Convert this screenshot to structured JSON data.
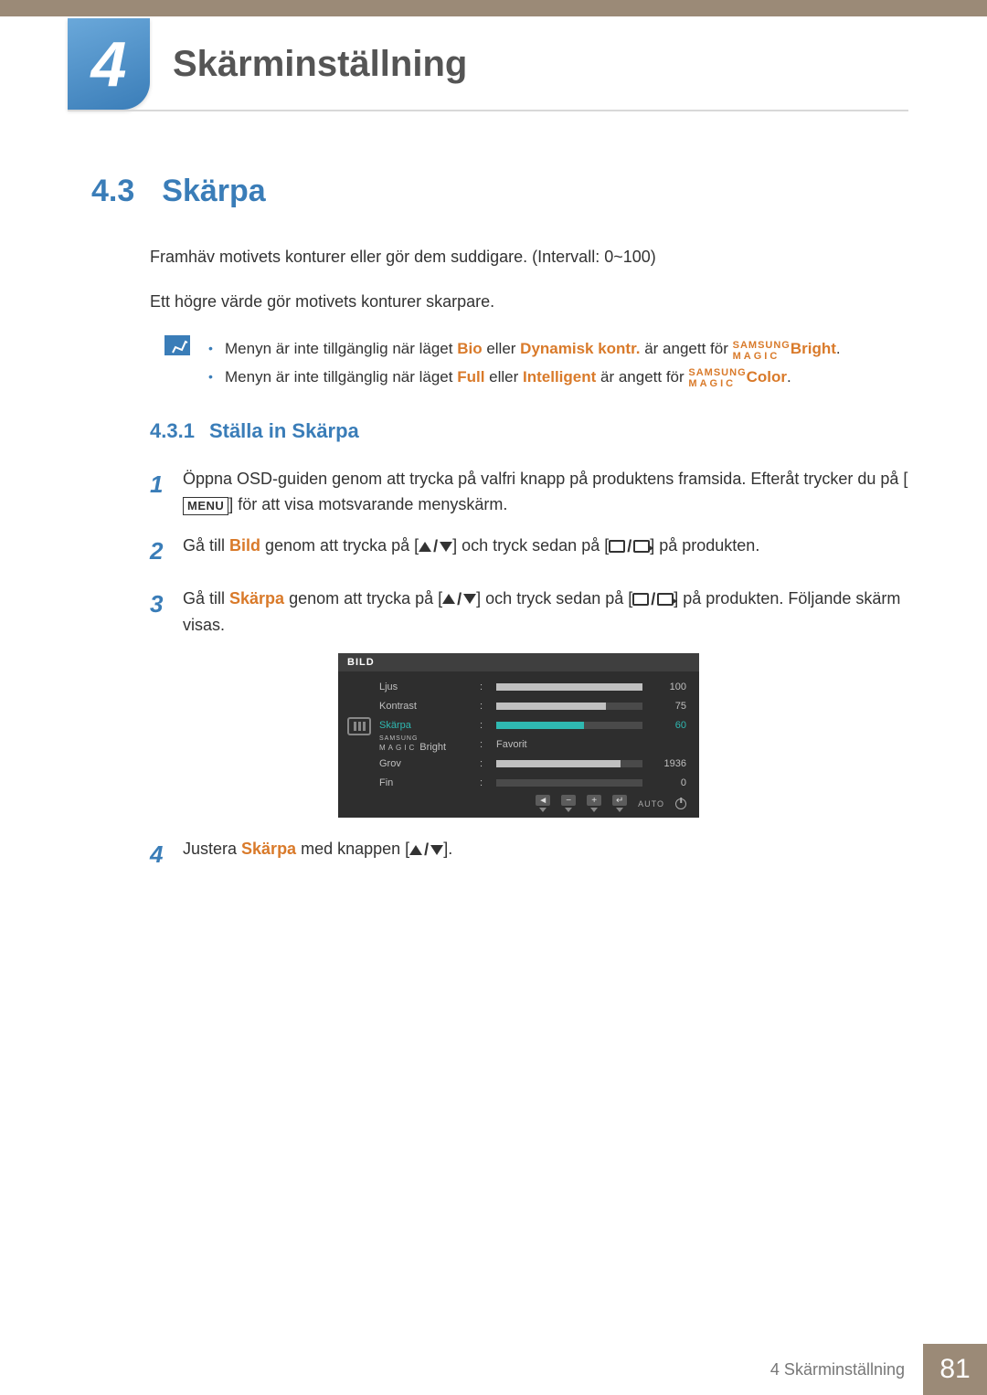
{
  "chapter": {
    "number": "4",
    "title": "Skärminställning"
  },
  "section": {
    "number": "4.3",
    "title": "Skärpa"
  },
  "intro": {
    "p1": "Framhäv motivets konturer eller gör dem suddigare. (Intervall: 0~100)",
    "p2": "Ett högre värde gör motivets konturer skarpare."
  },
  "notes": {
    "line1": {
      "pre": "Menyn är inte tillgänglig när läget ",
      "k1": "Bio",
      "mid1": " eller ",
      "k2": "Dynamisk kontr.",
      "mid2": " är angett för ",
      "brand_top": "SAMSUNG",
      "brand_bot": "MAGIC",
      "brand_tail": "Bright",
      "post": "."
    },
    "line2": {
      "pre": "Menyn är inte tillgänglig när läget ",
      "k1": "Full",
      "mid1": " eller ",
      "k2": "Intelligent",
      "mid2": " är angett för ",
      "brand_top": "SAMSUNG",
      "brand_bot": "MAGIC",
      "brand_tail": "Color",
      "post": "."
    }
  },
  "subsection": {
    "number": "4.3.1",
    "title": "Ställa in Skärpa"
  },
  "steps": {
    "s1": {
      "num": "1",
      "a": "Öppna OSD-guiden genom att trycka på valfri knapp på produktens framsida. Efteråt trycker du på [",
      "menu": "MENU",
      "b": "] för att visa motsvarande menyskärm."
    },
    "s2": {
      "num": "2",
      "a": "Gå till ",
      "kw": "Bild",
      "b": " genom att trycka på [",
      "c": "] och tryck sedan på [",
      "d": "] på produkten."
    },
    "s3": {
      "num": "3",
      "a": "Gå till ",
      "kw": "Skärpa",
      "b": " genom att trycka på [",
      "c": "] och tryck sedan på [",
      "d": "] på produkten. Följande skärm visas."
    },
    "s4": {
      "num": "4",
      "a": "Justera ",
      "kw": "Skärpa",
      "b": " med knappen [",
      "c": "]."
    }
  },
  "osd": {
    "title": "BILD",
    "rows": {
      "r1": {
        "label": "Ljus",
        "value": "100",
        "fill": 100
      },
      "r2": {
        "label": "Kontrast",
        "value": "75",
        "fill": 75
      },
      "r3": {
        "label": "Skärpa",
        "value": "60",
        "fill": 60
      },
      "r4": {
        "brand_top": "SAMSUNG",
        "brand_bot": "MAGIC",
        "tail": " Bright",
        "opt": "Favorit"
      },
      "r5": {
        "label": "Grov",
        "value": "1936",
        "fill": 85
      },
      "r6": {
        "label": "Fin",
        "value": "0",
        "fill": 0
      }
    },
    "footer": {
      "auto": "AUTO",
      "back": "◄",
      "minus": "−",
      "plus": "+",
      "enter": "↵"
    }
  },
  "footer": {
    "label": "4 Skärminställning",
    "page": "81"
  }
}
